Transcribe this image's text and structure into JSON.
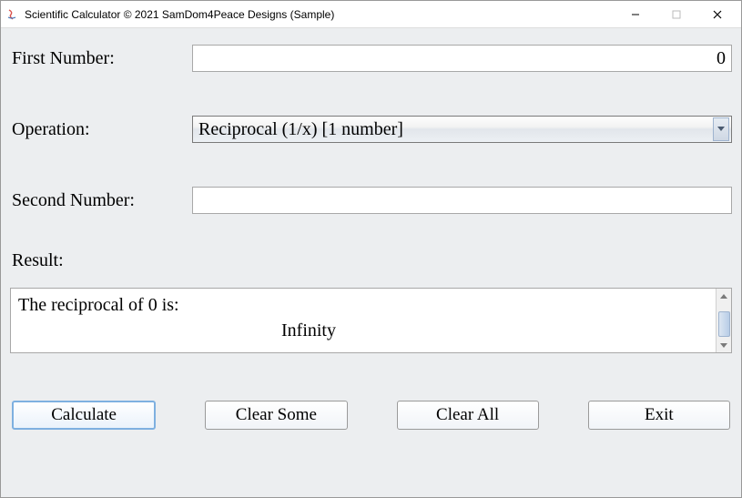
{
  "window": {
    "title": "Scientific Calculator © 2021 SamDom4Peace Designs (Sample)"
  },
  "labels": {
    "first_number": "First Number:",
    "operation": "Operation:",
    "second_number": "Second Number:",
    "result": "Result:"
  },
  "inputs": {
    "first_number_value": "0",
    "operation_value": "Reciprocal (1/x) [1 number]",
    "second_number_value": ""
  },
  "result": {
    "line1": "The reciprocal of 0 is:",
    "line2": "Infinity"
  },
  "buttons": {
    "calculate": "Calculate",
    "clear_some": "Clear Some",
    "clear_all": "Clear All",
    "exit": "Exit"
  }
}
